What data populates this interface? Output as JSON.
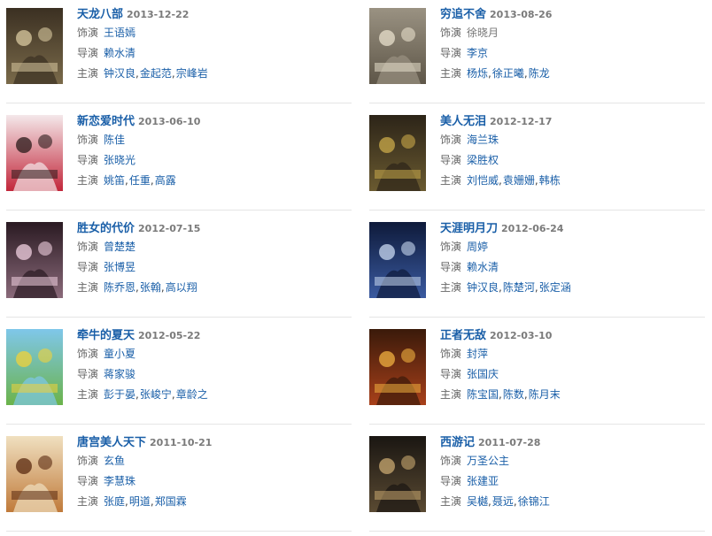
{
  "labels": {
    "role": "饰演",
    "director": "导演",
    "cast": "主演"
  },
  "colors": {
    "link": "#1a5fa8",
    "date": "#7a7a7a",
    "divider": "#e5e5e5"
  },
  "items": [
    {
      "title": "天龙八部",
      "date": "2013-12-22",
      "role": "王语嫣",
      "role_linked": true,
      "director": "赖水清",
      "cast": [
        "钟汉良",
        "金起范",
        "宗峰岩"
      ]
    },
    {
      "title": "穷追不舍",
      "date": "2013-08-26",
      "role": "徐晓月",
      "role_linked": false,
      "director": "李京",
      "cast": [
        "杨烁",
        "徐正曦",
        "陈龙"
      ]
    },
    {
      "title": "新恋爱时代",
      "date": "2013-06-10",
      "role": "陈佳",
      "role_linked": true,
      "director": "张晓光",
      "cast": [
        "姚笛",
        "任重",
        "高露"
      ]
    },
    {
      "title": "美人无泪",
      "date": "2012-12-17",
      "role": "海兰珠",
      "role_linked": true,
      "director": "梁胜权",
      "cast": [
        "刘恺威",
        "袁姗姗",
        "韩栋"
      ]
    },
    {
      "title": "胜女的代价",
      "date": "2012-07-15",
      "role": "曾楚楚",
      "role_linked": true,
      "director": "张博昱",
      "cast": [
        "陈乔恩",
        "张翰",
        "高以翔"
      ]
    },
    {
      "title": "天涯明月刀",
      "date": "2012-06-24",
      "role": "周婷",
      "role_linked": true,
      "director": "赖水清",
      "cast": [
        "钟汉良",
        "陈楚河",
        "张定涵"
      ]
    },
    {
      "title": "牵牛的夏天",
      "date": "2012-05-22",
      "role": "童小夏",
      "role_linked": true,
      "director": "蒋家骏",
      "cast": [
        "彭于晏",
        "张峻宁",
        "章龄之"
      ]
    },
    {
      "title": "正者无敌",
      "date": "2012-03-10",
      "role": "封萍",
      "role_linked": true,
      "director": "张国庆",
      "cast": [
        "陈宝国",
        "陈数",
        "陈月末"
      ]
    },
    {
      "title": "唐宫美人天下",
      "date": "2011-10-21",
      "role": "玄鱼",
      "role_linked": true,
      "director": "李慧珠",
      "cast": [
        "张庭",
        "明道",
        "郑国霖"
      ]
    },
    {
      "title": "西游记",
      "date": "2011-07-28",
      "role": "万圣公主",
      "role_linked": true,
      "director": "张建亚",
      "cast": [
        "吴樾",
        "聂远",
        "徐锦江"
      ]
    }
  ]
}
